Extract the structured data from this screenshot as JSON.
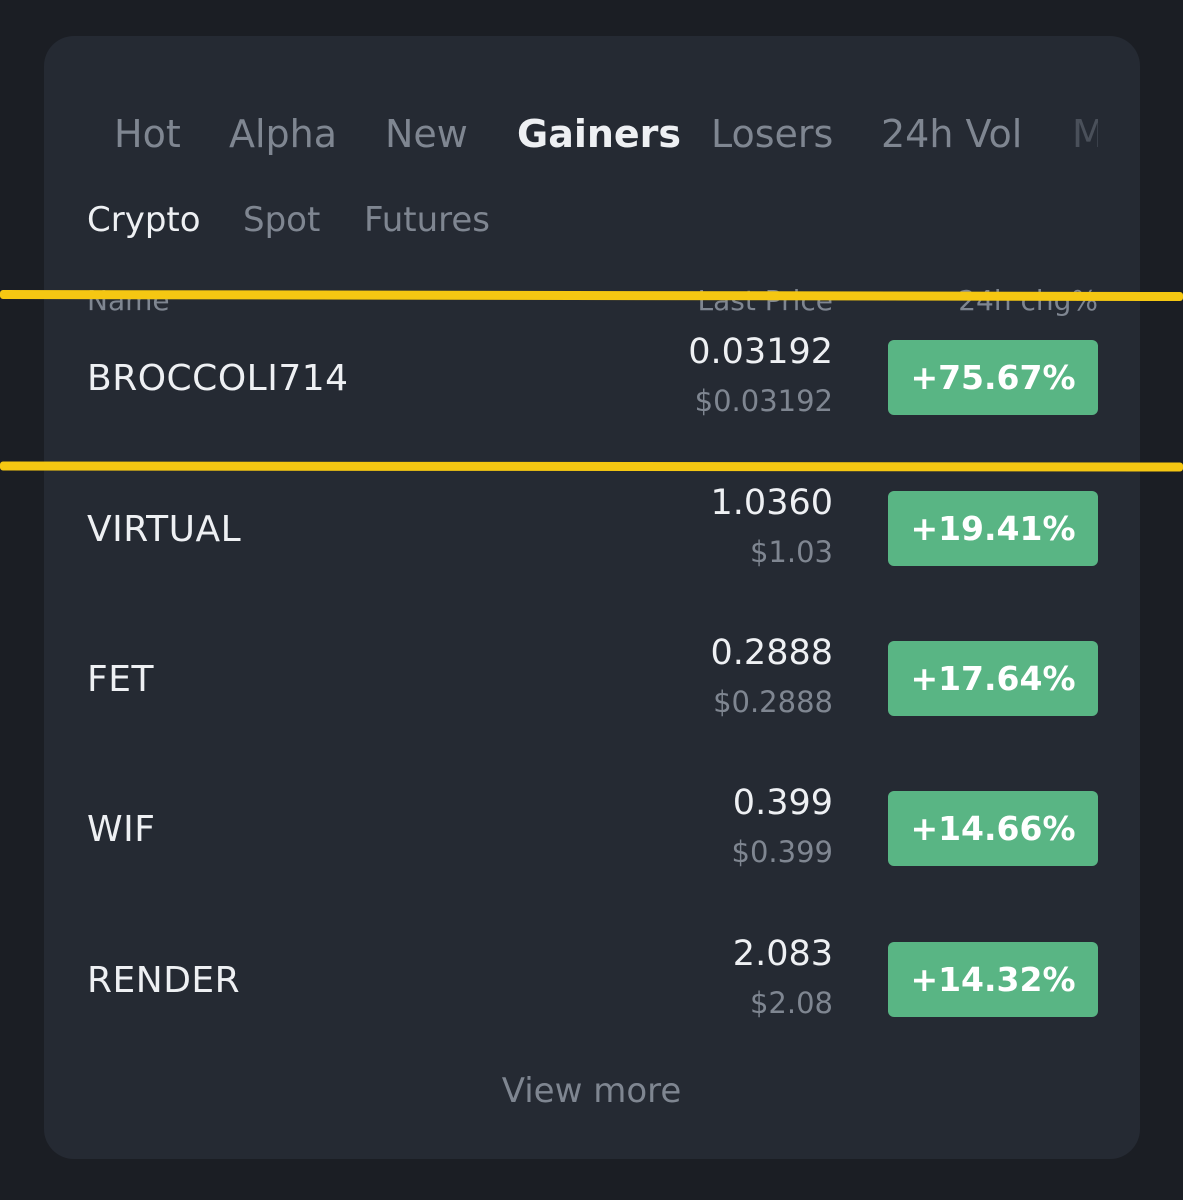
{
  "tabs": [
    "Hot",
    "Alpha",
    "New",
    "Gainers",
    "Losers",
    "24h Vol",
    "M"
  ],
  "active_tab": "Gainers",
  "subtabs": [
    "Crypto",
    "Spot",
    "Futures"
  ],
  "active_subtab": "Crypto",
  "columns": {
    "name": "Name",
    "last_price": "Last Price",
    "change": "24h chg%"
  },
  "rows": [
    {
      "name": "BROCCOLI714",
      "price": "0.03192",
      "usd": "$0.03192",
      "change": "+75.67%"
    },
    {
      "name": "VIRTUAL",
      "price": "1.0360",
      "usd": "$1.03",
      "change": "+19.41%"
    },
    {
      "name": "FET",
      "price": "0.2888",
      "usd": "$0.2888",
      "change": "+17.64%"
    },
    {
      "name": "WIF",
      "price": "0.399",
      "usd": "$0.399",
      "change": "+14.66%"
    },
    {
      "name": "RENDER",
      "price": "2.083",
      "usd": "$2.08",
      "change": "+14.32%"
    }
  ],
  "view_more": "View more",
  "colors": {
    "background": "#1b1e24",
    "card": "#252a33",
    "gain": "#59b584",
    "highlight": "#f5c712"
  }
}
